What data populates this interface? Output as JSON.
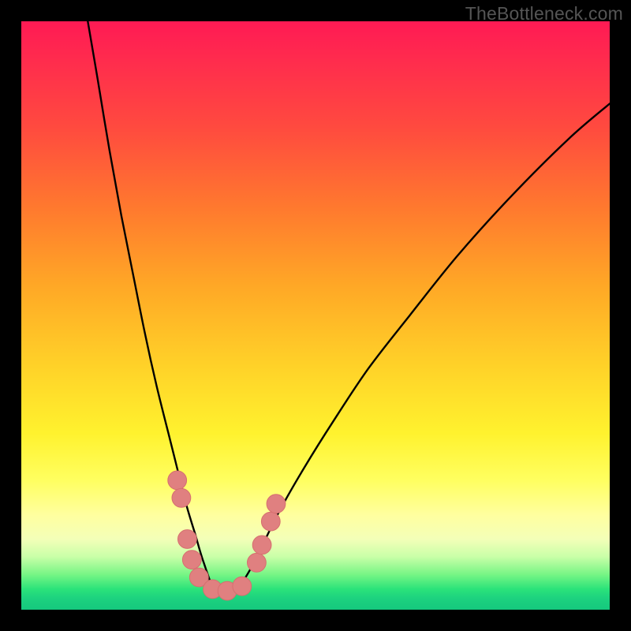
{
  "watermark": "TheBottleneck.com",
  "colors": {
    "frame": "#000000",
    "curve": "#000000",
    "marker": "#e08080",
    "marker_stroke": "#d66f6f",
    "gradient_top": "#ff1a54",
    "gradient_bottom": "#15c87e"
  },
  "chart_data": {
    "type": "line",
    "title": "",
    "xlabel": "",
    "ylabel": "",
    "xlim": [
      0,
      100
    ],
    "ylim": [
      0,
      100
    ],
    "note": "No axis/tick labels are visible; x and y are in percent of plot width/height. y=0 is the bottom (green) edge and y=100 is the top (red) edge. The curve is a V-shaped valley with its minimum near x≈33, y≈3.",
    "series": [
      {
        "name": "curve",
        "x": [
          11.3,
          13,
          15,
          17,
          19,
          21,
          23,
          25,
          26.5,
          28,
          29.5,
          31,
          33,
          35,
          37,
          39,
          41,
          44,
          48,
          53,
          59,
          66,
          74,
          83,
          93,
          100
        ],
        "y": [
          100,
          90,
          78,
          67,
          57,
          47,
          38,
          30,
          24,
          18,
          13,
          8,
          3,
          3,
          4,
          7,
          11,
          17,
          24,
          32,
          41,
          50,
          60,
          70,
          80,
          86
        ]
      }
    ],
    "markers": [
      {
        "x": 26.5,
        "y": 22.0,
        "r": 1.6
      },
      {
        "x": 27.2,
        "y": 19.0,
        "r": 1.6
      },
      {
        "x": 28.2,
        "y": 12.0,
        "r": 1.6
      },
      {
        "x": 29.0,
        "y": 8.5,
        "r": 1.6
      },
      {
        "x": 30.2,
        "y": 5.5,
        "r": 1.6
      },
      {
        "x": 32.5,
        "y": 3.5,
        "r": 1.6
      },
      {
        "x": 35.0,
        "y": 3.2,
        "r": 1.6
      },
      {
        "x": 37.5,
        "y": 4.0,
        "r": 1.6
      },
      {
        "x": 40.0,
        "y": 8.0,
        "r": 1.6
      },
      {
        "x": 40.9,
        "y": 11.0,
        "r": 1.6
      },
      {
        "x": 42.4,
        "y": 15.0,
        "r": 1.6
      },
      {
        "x": 43.3,
        "y": 18.0,
        "r": 1.6
      }
    ]
  }
}
